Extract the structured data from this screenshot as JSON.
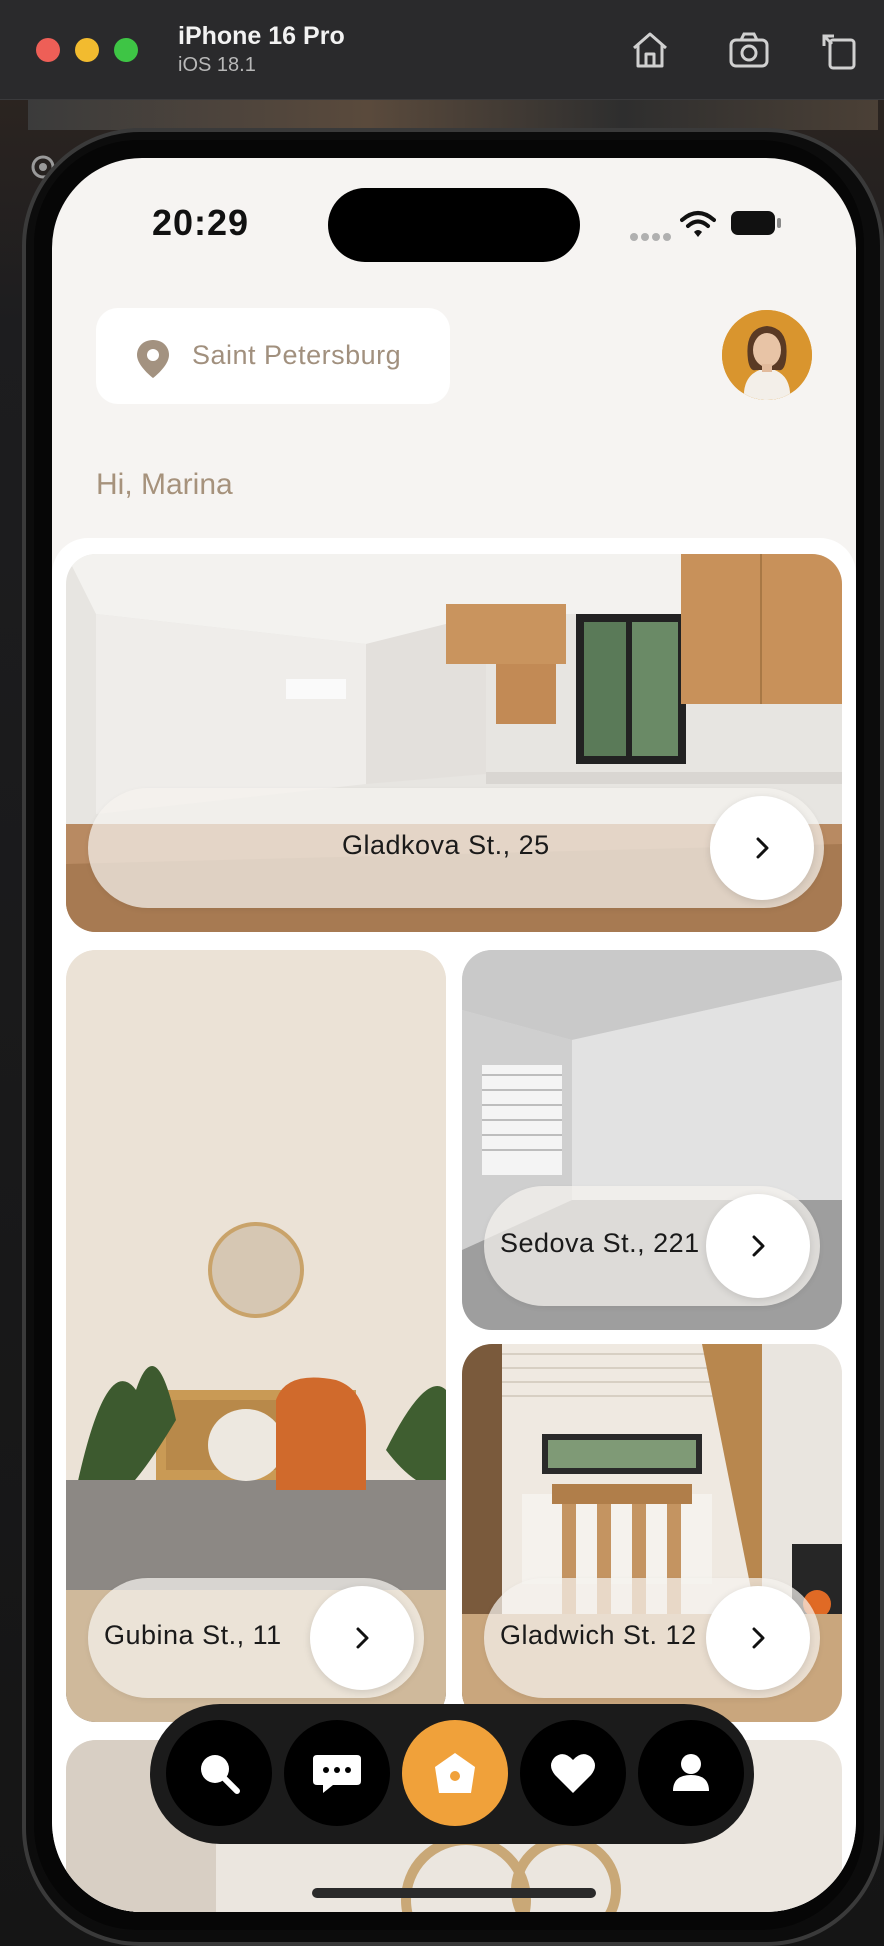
{
  "simulator": {
    "device_name": "iPhone 16 Pro",
    "os_version": "iOS 18.1",
    "toolbar_icons": [
      "home-icon",
      "screenshot-icon",
      "rotate-icon"
    ]
  },
  "status_bar": {
    "time": "20:29",
    "icons": [
      "signal-icon",
      "wifi-icon",
      "battery-icon"
    ]
  },
  "header": {
    "location": "Saint Petersburg",
    "location_icon": "map-pin-icon",
    "greeting": "Hi, Marina"
  },
  "properties": [
    {
      "address": "Gladkova St., 25"
    },
    {
      "address": "Gubina St., 11"
    },
    {
      "address": "Sedova St., 221"
    },
    {
      "address": "Gladwich St. 12"
    }
  ],
  "bottom_nav": {
    "items": [
      "search-icon",
      "chat-icon",
      "home-icon",
      "favorites-icon",
      "profile-icon"
    ],
    "active": "home-icon",
    "accent_color": "#f0a13a"
  },
  "colors": {
    "background": "#f6f4f2",
    "muted_text": "#a1907e",
    "nav_bg": "#1b1b1b"
  }
}
